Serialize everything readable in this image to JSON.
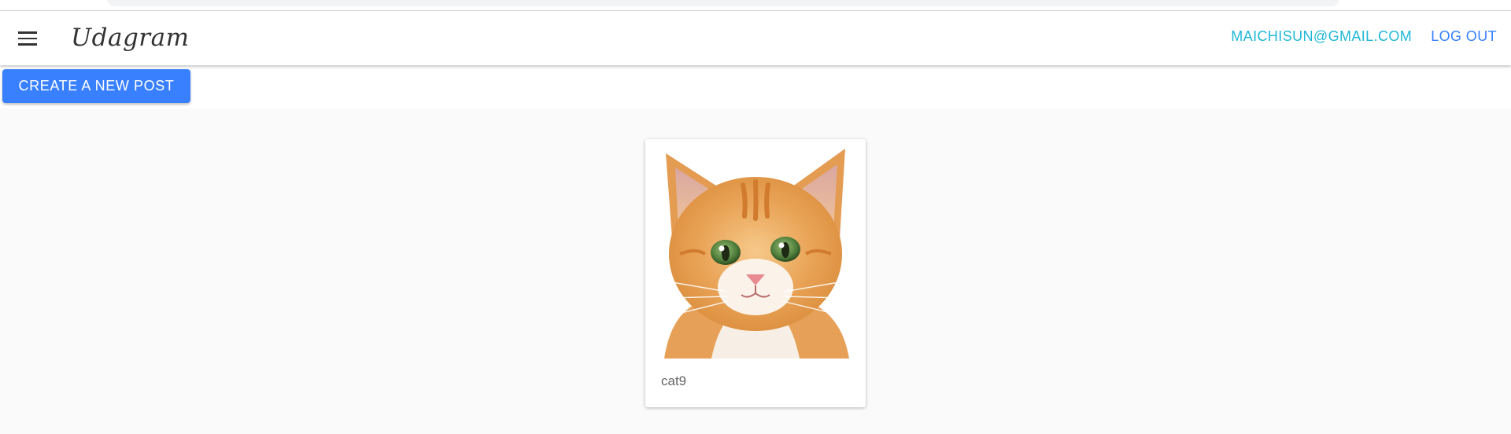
{
  "header": {
    "menu_icon": "hamburger-menu-icon",
    "brand": "Udagram",
    "user_email": "MAICHISUN@GMAIL.COM",
    "logout_label": "LOG OUT"
  },
  "actions": {
    "create_post_label": "CREATE A NEW POST"
  },
  "feed": {
    "posts": [
      {
        "caption": "cat9",
        "image": "orange-tabby-kitten-photo"
      }
    ]
  },
  "colors": {
    "primary": "#3880ff",
    "email_link": "#1fb8d6",
    "background": "#fafafa"
  }
}
